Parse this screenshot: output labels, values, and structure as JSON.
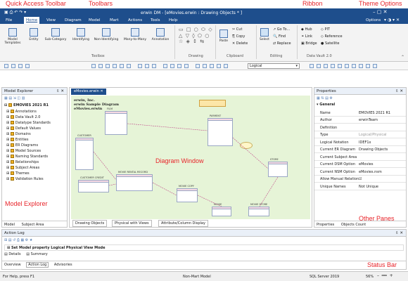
{
  "annotations": {
    "quick_access": "Quick Access Toolbar",
    "toolbars": "Toolbars",
    "ribbon": "Ribbon",
    "theme_options": "Theme Options",
    "diagram_window": "Diagram Window",
    "model_explorer": "Model Explorer",
    "other_panes": "Other Panes",
    "status_bar": "Status Bar"
  },
  "window": {
    "title": "erwin DM - [eMovies.erwin : Drawing Objects * ]",
    "options": "Options"
  },
  "menu": [
    "File",
    "Home",
    "View",
    "Diagram",
    "Model",
    "Mart",
    "Actions",
    "Tools",
    "Help"
  ],
  "ribbon": {
    "toolbox": {
      "label": "Toolbox",
      "buttons": [
        "Model Templates",
        "Entity",
        "Sub-Category",
        "Identifying",
        "Non-Identifying",
        "Many-to-Many",
        "Annotation"
      ]
    },
    "drawing_label": "Drawing",
    "clipboard": {
      "label": "Clipboard",
      "paste": "Paste",
      "cut": "Cut",
      "copy": "Copy",
      "delete": "Delete"
    },
    "editing": {
      "label": "Editing",
      "select": "Select",
      "goto": "Go To...",
      "find": "Find",
      "replace": "Replace"
    },
    "datavault": {
      "label": "Data Vault 2.0",
      "hub": "Hub",
      "pit": "PIT",
      "link": "Link",
      "reference": "Reference",
      "bridge": "Bridge",
      "satellite": "Satellite"
    }
  },
  "toolbar2": {
    "notation": "Logical"
  },
  "model_explorer": {
    "title": "Model Explorer",
    "root": "EMOVIES 2021 R1",
    "items": [
      "Annotations",
      "Data Vault 2.0",
      "Datatype Standards",
      "Default Values",
      "Domains",
      "Entities",
      "ER Diagrams",
      "Model Sources",
      "Naming Standards",
      "Relationships",
      "Subject Areas",
      "Themes",
      "Validation Rules"
    ],
    "tab_model": "Model",
    "tab_subject": "Subject Area"
  },
  "diagram": {
    "tab": "eMovies.erwin",
    "header_lines": [
      "erwin, Inc.",
      "erwin Sample Diagram",
      "eMovies.erwin"
    ],
    "bottom_tabs": [
      "Drawing Objects",
      "Physical with Views",
      "Attribute/Column Display"
    ],
    "entities": [
      "FILM",
      "PAYMENT",
      "CUSTOMER",
      "CUSTOMER CREDIT",
      "MOVIE RENTAL RECORD",
      "MOVIE COPY",
      "MOVIE",
      "STORE",
      "MOVIE STORE"
    ]
  },
  "properties": {
    "title": "Properties",
    "section": "General",
    "rows": [
      {
        "k": "Name",
        "v": "EMOVIES 2021 R1"
      },
      {
        "k": "Author",
        "v": "erwinTeam"
      },
      {
        "k": "Definition",
        "v": ""
      },
      {
        "k": "Type",
        "v": "Logical/Physical"
      },
      {
        "k": "Logical Notation",
        "v": "IDEF1x"
      },
      {
        "k": "Current ER Diagram",
        "v": "Drawing Objects"
      },
      {
        "k": "Current Subject Area",
        "v": ""
      },
      {
        "k": "Current DSM Option",
        "v": "eMovies"
      },
      {
        "k": "Current NSM Option",
        "v": "eMovies.nsm"
      },
      {
        "k": "Allow Manual Relation",
        "v": ""
      },
      {
        "k": "Unique Names",
        "v": "Not Unique"
      }
    ],
    "tab_properties": "Properties",
    "tab_objects": "Objects Count"
  },
  "action_log": {
    "title": "Action Log",
    "entry": "Set Model property Logical Physical View Mode",
    "details": "Details",
    "summary": "Summary",
    "tabs": [
      "Overview",
      "Action Log",
      "Advisories"
    ]
  },
  "status": {
    "help": "For Help, press F1",
    "mode": "Non-Mart Model",
    "server": "SQL Server 2019",
    "zoom": "56%"
  },
  "colors": {
    "titlebar": "#1e4e8c",
    "annotation": "#e8242a",
    "diagram_bg": "#e6f4d7"
  }
}
